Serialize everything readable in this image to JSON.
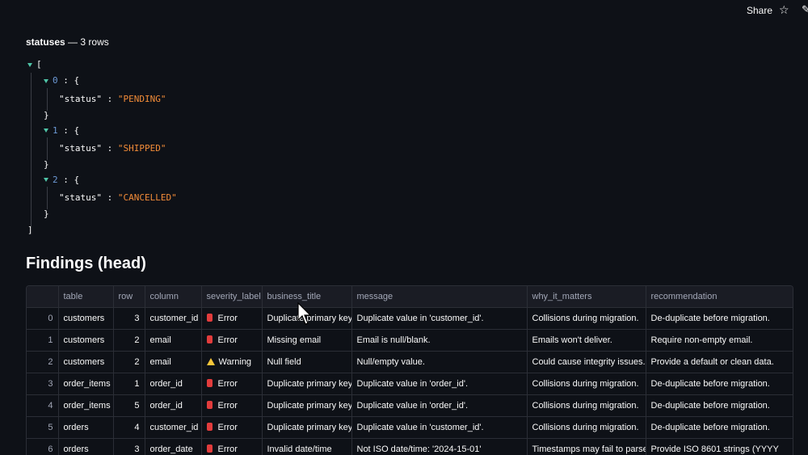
{
  "topbar": {
    "share_label": "Share",
    "star_icon": "star-icon",
    "edit_icon": "pencil-icon"
  },
  "json_section": {
    "label_name": "statuses",
    "label_sep": "—",
    "label_count": "3 rows",
    "open_bracket": "[",
    "close_bracket": "]",
    "items": [
      {
        "index": "0",
        "key": "\"status\"",
        "value": "\"PENDING\""
      },
      {
        "index": "1",
        "key": "\"status\"",
        "value": "\"SHIPPED\""
      },
      {
        "index": "2",
        "key": "\"status\"",
        "value": "\"CANCELLED\""
      }
    ]
  },
  "findings": {
    "heading": "Findings (head)",
    "columns": [
      "",
      "table",
      "row",
      "column",
      "severity_label",
      "business_title",
      "message",
      "why_it_matters",
      "recommendation"
    ],
    "rows": [
      {
        "idx": "0",
        "table": "customers",
        "row": "3",
        "column": "customer_id",
        "severity": "Error",
        "severity_type": "error",
        "business_title": "Duplicate primary key",
        "message": "Duplicate value in 'customer_id'.",
        "why": "Collisions during migration.",
        "recommendation": "De-duplicate before migration."
      },
      {
        "idx": "1",
        "table": "customers",
        "row": "2",
        "column": "email",
        "severity": "Error",
        "severity_type": "error",
        "business_title": "Missing email",
        "message": "Email is null/blank.",
        "why": "Emails won't deliver.",
        "recommendation": "Require non-empty email."
      },
      {
        "idx": "2",
        "table": "customers",
        "row": "2",
        "column": "email",
        "severity": "Warning",
        "severity_type": "warning",
        "business_title": "Null field",
        "message": "Null/empty value.",
        "why": "Could cause integrity issues.",
        "recommendation": "Provide a default or clean data."
      },
      {
        "idx": "3",
        "table": "order_items",
        "row": "1",
        "column": "order_id",
        "severity": "Error",
        "severity_type": "error",
        "business_title": "Duplicate primary key",
        "message": "Duplicate value in 'order_id'.",
        "why": "Collisions during migration.",
        "recommendation": "De-duplicate before migration."
      },
      {
        "idx": "4",
        "table": "order_items",
        "row": "5",
        "column": "order_id",
        "severity": "Error",
        "severity_type": "error",
        "business_title": "Duplicate primary key",
        "message": "Duplicate value in 'order_id'.",
        "why": "Collisions during migration.",
        "recommendation": "De-duplicate before migration."
      },
      {
        "idx": "5",
        "table": "orders",
        "row": "4",
        "column": "customer_id",
        "severity": "Error",
        "severity_type": "error",
        "business_title": "Duplicate primary key",
        "message": "Duplicate value in 'customer_id'.",
        "why": "Collisions during migration.",
        "recommendation": "De-duplicate before migration."
      },
      {
        "idx": "6",
        "table": "orders",
        "row": "3",
        "column": "order_date",
        "severity": "Error",
        "severity_type": "error",
        "business_title": "Invalid date/time",
        "message": "Not ISO date/time: '2024-15-01'",
        "why": "Timestamps may fail to parse.",
        "recommendation": "Provide ISO 8601 strings (YYYY"
      }
    ]
  },
  "colors": {
    "background": "#0e1117",
    "string": "#f28c38",
    "number": "#6d9ad6",
    "caret": "#4fc4a7",
    "error": "#e23c3c",
    "warning": "#f7c63a"
  }
}
